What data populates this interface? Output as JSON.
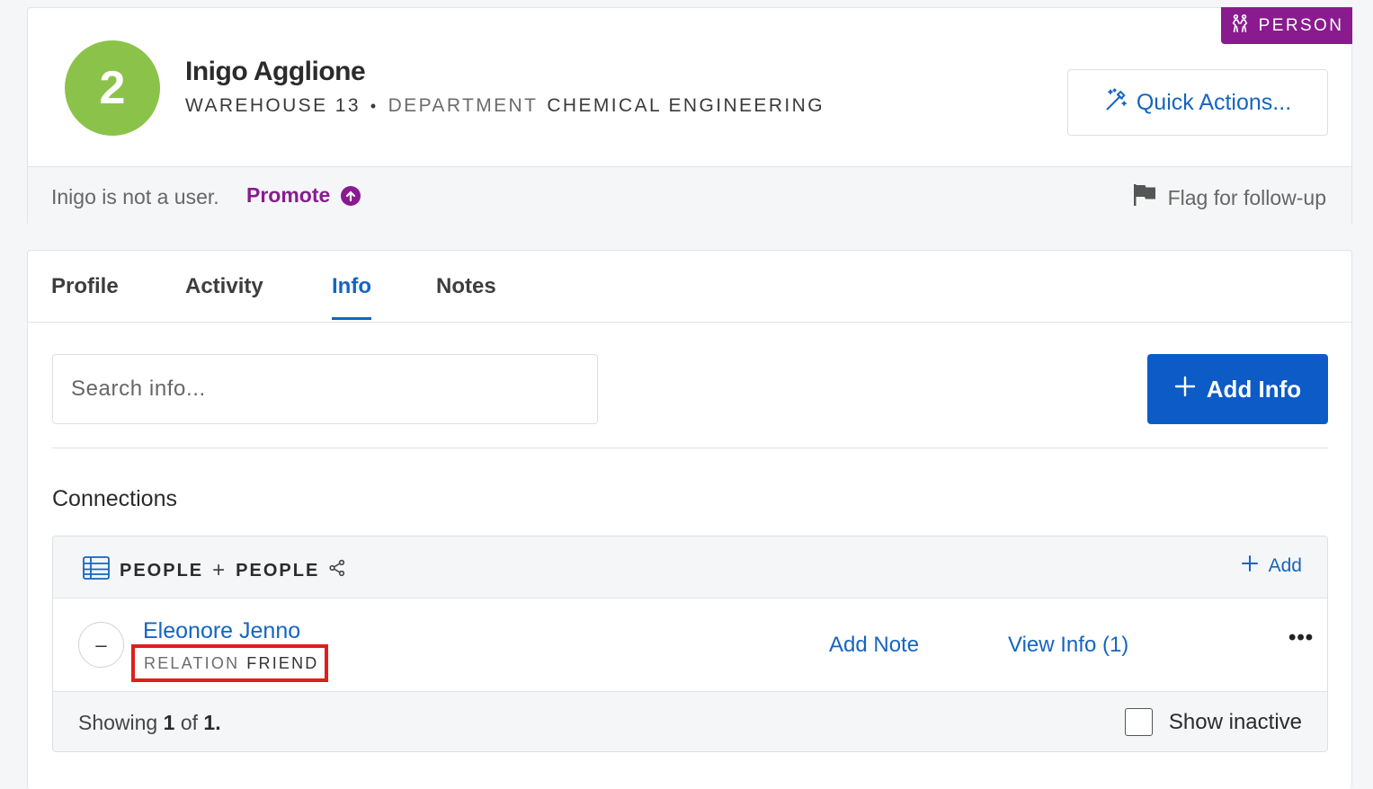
{
  "header": {
    "avatar_number": "2",
    "name": "Inigo Agglione",
    "warehouse": "WAREHOUSE 13",
    "department_key": "DEPARTMENT",
    "department_value": "CHEMICAL ENGINEERING",
    "badge": "PERSON",
    "quick_actions": "Quick Actions..."
  },
  "status": {
    "text": "Inigo is not a user.",
    "promote": "Promote",
    "flag": "Flag for follow-up"
  },
  "tabs": [
    {
      "label": "Profile"
    },
    {
      "label": "Activity"
    },
    {
      "label": "Info",
      "active": true
    },
    {
      "label": "Notes"
    }
  ],
  "search": {
    "placeholder": "Search info..."
  },
  "add_info": "Add Info",
  "connections": {
    "title": "Connections",
    "group_left": "PEOPLE",
    "group_right": "PEOPLE",
    "add": "Add",
    "rows": [
      {
        "name": "Eleonore Jenno",
        "relation_key": "RELATION",
        "relation_value": "FRIEND",
        "add_note": "Add Note",
        "view_info": "View Info (1)"
      }
    ],
    "footer": {
      "showing_prefix": "Showing",
      "shown": "1",
      "of": "of",
      "total": "1",
      "suffix": ".",
      "show_inactive": "Show inactive"
    }
  },
  "colors": {
    "brand_purple": "#8a1b8f",
    "link_blue": "#1565c0",
    "primary_button": "#0d5bc7",
    "avatar_green": "#8bc34a",
    "highlight_red": "#e11d1d"
  }
}
